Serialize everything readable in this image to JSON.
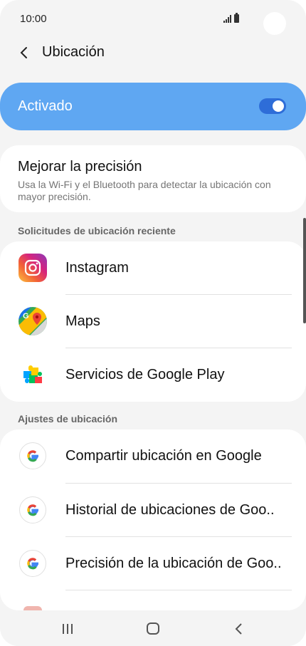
{
  "status_bar": {
    "time": "10:00"
  },
  "header": {
    "title": "Ubicación"
  },
  "master_toggle": {
    "label": "Activado",
    "on": true
  },
  "precision": {
    "title": "Mejorar la precisión",
    "description": "Usa la Wi-Fi y el Bluetooth para detectar la ubicación con mayor precisión."
  },
  "recent_requests": {
    "header": "Solicitudes de ubicación reciente",
    "items": [
      {
        "label": "Instagram",
        "icon": "instagram-icon"
      },
      {
        "label": "Maps",
        "icon": "google-maps-icon"
      },
      {
        "label": "Servicios de Google Play",
        "icon": "google-play-services-icon"
      }
    ]
  },
  "location_settings": {
    "header": "Ajustes de ubicación",
    "items": [
      {
        "label": "Compartir ubicación en Google",
        "icon": "google-icon"
      },
      {
        "label": "Historial de ubicaciones de Goo..",
        "icon": "google-icon"
      },
      {
        "label": "Precisión de la ubicación de Goo..",
        "icon": "google-icon"
      }
    ]
  },
  "nav_bar": {
    "buttons": [
      "recents-icon",
      "home-icon",
      "back-icon"
    ]
  },
  "colors": {
    "accent": "#5fa7f2",
    "switch": "#2e6dd8",
    "background": "#f4f4f4"
  }
}
